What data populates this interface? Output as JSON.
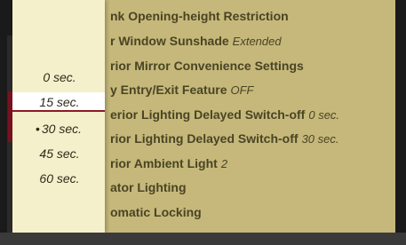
{
  "popup": {
    "options": [
      {
        "label": "0 sec.",
        "bullet": ""
      },
      {
        "label": "15 sec.",
        "bullet": ""
      },
      {
        "label": "30 sec.",
        "bullet": "•"
      },
      {
        "label": "45 sec.",
        "bullet": ""
      },
      {
        "label": "60 sec.",
        "bullet": ""
      }
    ],
    "highlighted_option": "15 sec.",
    "active_option": "30 sec."
  },
  "menu": {
    "items": [
      {
        "label": "nk Opening-height Restriction",
        "value": ""
      },
      {
        "label": "r Window Sunshade",
        "value": "Extended"
      },
      {
        "label": "rior Mirror Convenience Settings",
        "value": ""
      },
      {
        "label": "y Entry/Exit Feature",
        "value": "OFF"
      },
      {
        "label": "erior Lighting Delayed Switch-off",
        "value": "0 sec."
      },
      {
        "label": "rior Lighting Delayed Switch-off",
        "value": "30 sec."
      },
      {
        "label": "rior Ambient Light",
        "value": "2"
      },
      {
        "label": "ator Lighting",
        "value": ""
      },
      {
        "label": "omatic Locking",
        "value": ""
      }
    ]
  },
  "colors": {
    "screen_background": "#c5b87a",
    "popup_background": "#f4f0cc",
    "selection_underline": "#8a1a20",
    "menu_text": "#4a4424",
    "scroll_thumb": "#7a1020"
  }
}
